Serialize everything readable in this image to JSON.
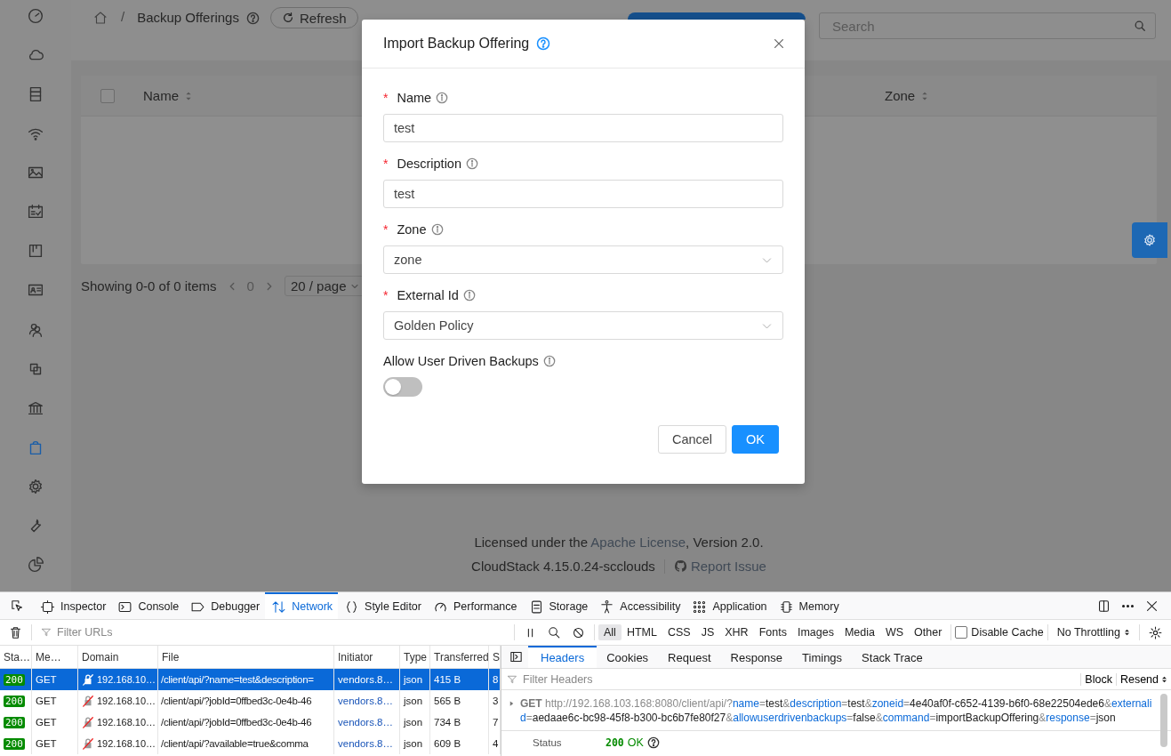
{
  "sidebar": {
    "items": [
      {
        "selected": false
      },
      {
        "selected": false
      },
      {
        "selected": false
      },
      {
        "selected": false
      },
      {
        "selected": false
      },
      {
        "selected": false
      },
      {
        "selected": false
      },
      {
        "selected": false
      },
      {
        "selected": false
      },
      {
        "selected": false
      },
      {
        "selected": false
      },
      {
        "selected": true
      },
      {
        "selected": false
      },
      {
        "selected": false
      },
      {
        "selected": false
      }
    ]
  },
  "header": {
    "separator": "/",
    "breadcrumb": "Backup Offerings",
    "refresh": "Refresh",
    "search": {
      "placeholder": "Search"
    }
  },
  "table": {
    "select_all": {
      "checked": false
    },
    "columns": [
      {
        "label": "Name"
      },
      {
        "label": "Zone"
      }
    ]
  },
  "pagination": {
    "summary": "Showing 0-0 of 0 items",
    "page": "0",
    "page_size": "20 / page"
  },
  "footer": {
    "license_before": "Licensed under the ",
    "license_link": "Apache License",
    "license_after": ", Version 2.0.",
    "version": "CloudStack 4.15.0.24-scclouds",
    "report": "Report Issue"
  },
  "dialog": {
    "title": "Import Backup Offering",
    "fields": [
      {
        "kind": "input",
        "marker": "*",
        "label": "Name",
        "value": "test"
      },
      {
        "kind": "input",
        "marker": "*",
        "label": "Description",
        "value": "test"
      },
      {
        "kind": "select",
        "marker": "*",
        "label": "Zone",
        "value": "zone"
      },
      {
        "kind": "select",
        "marker": "*",
        "label": "External Id",
        "value": "Golden Policy"
      },
      {
        "kind": "switch",
        "label": "Allow User Driven Backups",
        "on": false
      }
    ],
    "buttons": [
      {
        "label": "Cancel",
        "primary": false
      },
      {
        "label": "OK",
        "primary": true
      }
    ]
  },
  "devtools": {
    "tabs": [
      {
        "label": "Inspector",
        "selected": false
      },
      {
        "label": "Console",
        "selected": false
      },
      {
        "label": "Debugger",
        "selected": false
      },
      {
        "label": "Network",
        "selected": true
      },
      {
        "label": "Style Editor",
        "selected": false
      },
      {
        "label": "Performance",
        "selected": false
      },
      {
        "label": "Storage",
        "selected": false
      },
      {
        "label": "Accessibility",
        "selected": false
      },
      {
        "label": "Application",
        "selected": false
      },
      {
        "label": "Memory",
        "selected": false
      }
    ],
    "filter": {
      "placeholder": "Filter URLs"
    },
    "types": [
      {
        "label": "All",
        "selected": true
      },
      {
        "label": "HTML",
        "selected": false
      },
      {
        "label": "CSS",
        "selected": false
      },
      {
        "label": "JS",
        "selected": false
      },
      {
        "label": "XHR",
        "selected": false
      },
      {
        "label": "Fonts",
        "selected": false
      },
      {
        "label": "Images",
        "selected": false
      },
      {
        "label": "Media",
        "selected": false
      },
      {
        "label": "WS",
        "selected": false
      },
      {
        "label": "Other",
        "selected": false
      }
    ],
    "disable_cache": {
      "label": "Disable Cache",
      "checked": false
    },
    "throttling": "No Throttling",
    "columns": [
      "Sta…",
      "Me…",
      "Domain",
      "File",
      "Initiator",
      "Type",
      "Transferred",
      "S"
    ],
    "requests": [
      {
        "selected": true,
        "status": "200",
        "method": "GET",
        "domain": "192.168.10…",
        "file": "/client/api/?name=test&description=",
        "initiator": "vendors.8…",
        "type": "json",
        "transferred": "415 B",
        "size": "8"
      },
      {
        "selected": false,
        "status": "200",
        "method": "GET",
        "domain": "192.168.10…",
        "file": "/client/api/?jobId=0ffbed3c-0e4b-46",
        "initiator": "vendors.8…",
        "type": "json",
        "transferred": "565 B",
        "size": "3"
      },
      {
        "selected": false,
        "status": "200",
        "method": "GET",
        "domain": "192.168.10…",
        "file": "/client/api/?jobId=0ffbed3c-0e4b-46",
        "initiator": "vendors.8…",
        "type": "json",
        "transferred": "734 B",
        "size": "7"
      },
      {
        "selected": false,
        "status": "200",
        "method": "GET",
        "domain": "192.168.10…",
        "file": "/client/api/?available=true&comma",
        "initiator": "vendors.8…",
        "type": "json",
        "transferred": "609 B",
        "size": "4"
      }
    ],
    "detail_tabs": [
      {
        "label": "Headers",
        "selected": true
      },
      {
        "label": "Cookies",
        "selected": false
      },
      {
        "label": "Request",
        "selected": false
      },
      {
        "label": "Response",
        "selected": false
      },
      {
        "label": "Timings",
        "selected": false
      },
      {
        "label": "Stack Trace",
        "selected": false
      }
    ],
    "filter_headers": {
      "placeholder": "Filter Headers"
    },
    "block": "Block",
    "resend": "Resend",
    "request_method": "GET",
    "url_parts": [
      {
        "kind": "base",
        "text": "http://192.168.103.168:8080/client/api/"
      },
      {
        "kind": "sep",
        "text": "?"
      },
      {
        "kind": "key",
        "text": "name"
      },
      {
        "kind": "sep",
        "text": "="
      },
      {
        "kind": "value",
        "text": "test"
      },
      {
        "kind": "sep",
        "text": "&"
      },
      {
        "kind": "key",
        "text": "description"
      },
      {
        "kind": "sep",
        "text": "="
      },
      {
        "kind": "value",
        "text": "test"
      },
      {
        "kind": "sep",
        "text": "&"
      },
      {
        "kind": "key",
        "text": "zoneid"
      },
      {
        "kind": "sep",
        "text": "="
      },
      {
        "kind": "value",
        "text": "4e40af0f-c652-4139-b6f0-68e22504ede6"
      },
      {
        "kind": "sep",
        "text": "&"
      },
      {
        "kind": "key",
        "text": "externalid"
      },
      {
        "kind": "sep",
        "text": "="
      },
      {
        "kind": "value",
        "text": "aedaae6c-bc98-45f8-b300-bc6b7fe80f27"
      },
      {
        "kind": "sep",
        "text": "&"
      },
      {
        "kind": "key",
        "text": "allowuserdrivenbackups"
      },
      {
        "kind": "sep",
        "text": "="
      },
      {
        "kind": "value",
        "text": "false"
      },
      {
        "kind": "sep",
        "text": "&"
      },
      {
        "kind": "key",
        "text": "command"
      },
      {
        "kind": "sep",
        "text": "="
      },
      {
        "kind": "value",
        "text": "importBackupOffering"
      },
      {
        "kind": "sep",
        "text": "&"
      },
      {
        "kind": "key",
        "text": "response"
      },
      {
        "kind": "sep",
        "text": "="
      },
      {
        "kind": "value",
        "text": "json"
      }
    ],
    "status_label": "Status",
    "status_code": "200",
    "status_text": "OK"
  }
}
